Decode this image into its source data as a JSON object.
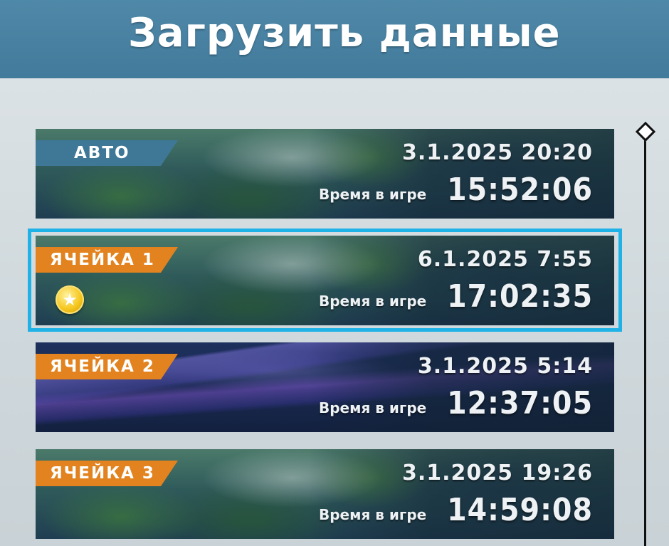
{
  "header": {
    "title": "Загрузить данные"
  },
  "common": {
    "playtime_label": "Время в игре"
  },
  "slots": [
    {
      "tag": "АВТО",
      "date": "3.1.2025 20:20",
      "playtime": "15:52:06"
    },
    {
      "tag": "ЯЧЕЙКА 1",
      "date": "6.1.2025 7:55",
      "playtime": "17:02:35",
      "badge_icon": "star-icon"
    },
    {
      "tag": "ЯЧЕЙКА 2",
      "date": "3.1.2025 5:14",
      "playtime": "12:37:05"
    },
    {
      "tag": "ЯЧЕЙКА 3",
      "date": "3.1.2025 19:26",
      "playtime": "14:59:08"
    }
  ],
  "colors": {
    "header_bg": "#4a83a4",
    "auto_tag": "#3f7896",
    "slot_tag": "#e2831f",
    "selection": "#1fb2e6"
  }
}
